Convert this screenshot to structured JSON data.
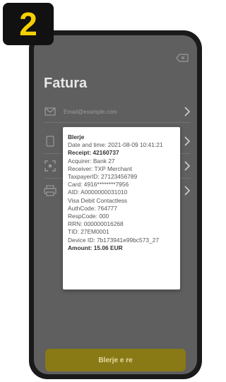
{
  "step": {
    "number": "2"
  },
  "screen": {
    "title": "Fatura",
    "email_placeholder": "Email@example.com"
  },
  "receipt": {
    "lines": [
      {
        "text": "Blerje",
        "bold": true
      },
      {
        "text": "Date and time: 2021-08-09 10:41:21",
        "bold": false
      },
      {
        "text": "Receipt: 42160737",
        "bold": true
      },
      {
        "text": "Acquirer: Bank 27",
        "bold": false
      },
      {
        "text": "Receiver: TXP Merchant",
        "bold": false
      },
      {
        "text": "TaxpayerID: 27123456789",
        "bold": false
      },
      {
        "text": "Card: 4916********7956",
        "bold": false
      },
      {
        "text": "AID: A0000000031010",
        "bold": false
      },
      {
        "text": "Visa Debit Contactless",
        "bold": false
      },
      {
        "text": "AuthCode: 764777",
        "bold": false
      },
      {
        "text": "RespCode: 000",
        "bold": false
      },
      {
        "text": "RRN: 000000016268",
        "bold": false
      },
      {
        "text": "TID: 27EM0001",
        "bold": false
      },
      {
        "text": "Device ID: 7b173941e99bc573_27",
        "bold": false
      },
      {
        "text": "Amount: 15.06 EUR",
        "bold": true
      }
    ]
  },
  "buttons": {
    "primary": "Blerje e re"
  },
  "colors": {
    "badge_bg": "#111111",
    "badge_text": "#f5d000",
    "button_bg": "#8a7a16"
  },
  "icons": [
    "backspace-icon",
    "email-icon",
    "phone-icon",
    "qr-icon",
    "printer-icon",
    "chevron-right-icon"
  ]
}
